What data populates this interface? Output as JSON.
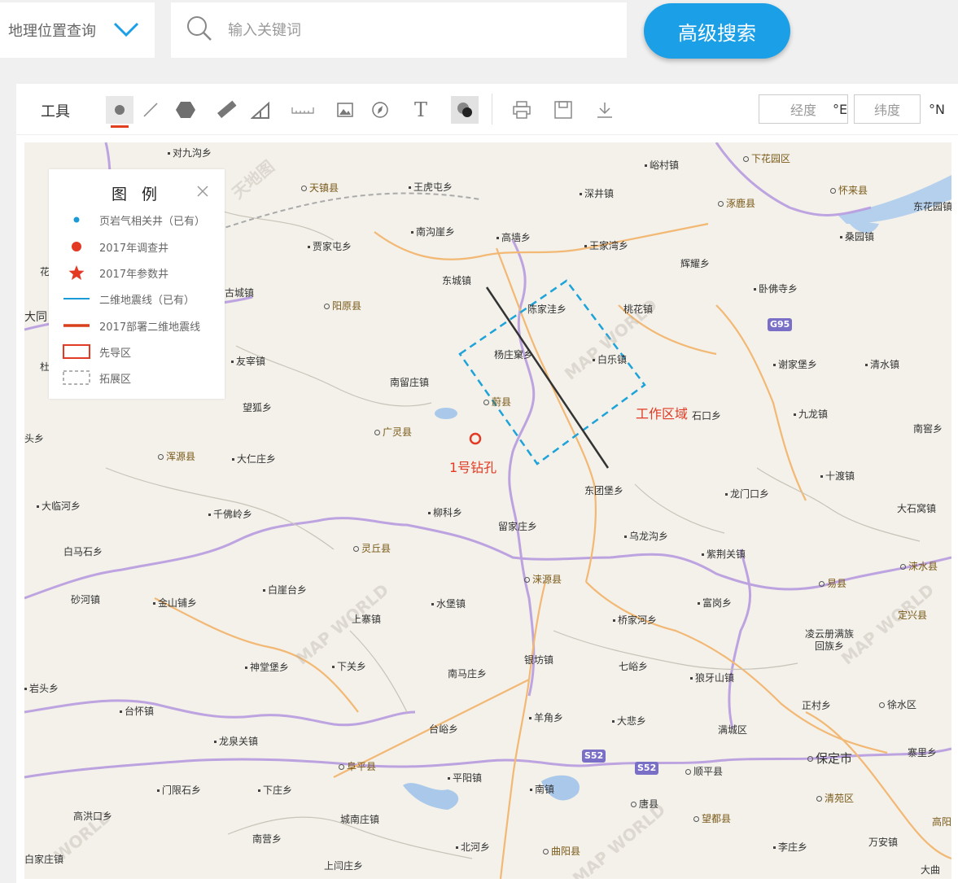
{
  "topbar": {
    "geo_select_label": "地理位置查询",
    "search_placeholder": "输入关键词",
    "advanced_search_label": "高级搜索",
    "accent_color": "#1ba0e8"
  },
  "toolbar": {
    "label": "工具",
    "tools": [
      "point-tool",
      "line-tool",
      "polygon-tool",
      "ruler-tool",
      "area-measure-tool",
      "scale-tool",
      "image-tool",
      "compass-tool",
      "text-tool",
      "layer-tool",
      "print-tool",
      "save-tool",
      "download-tool"
    ],
    "longitude_placeholder": "经度",
    "longitude_unit": "°E",
    "latitude_placeholder": "纬度",
    "latitude_unit": "°N"
  },
  "legend": {
    "title": "图 例",
    "items": [
      {
        "label": "页岩气相关井（已有）",
        "symbol": "blue-dot",
        "color": "#1a9ad6"
      },
      {
        "label": "2017年调查井",
        "symbol": "red-dot",
        "color": "#e23a24"
      },
      {
        "label": "2017年参数井",
        "symbol": "red-star",
        "color": "#e23a24"
      },
      {
        "label": "二维地震线（已有）",
        "symbol": "blue-line",
        "color": "#1a9ad6"
      },
      {
        "label": "2017部署二维地震线",
        "symbol": "red-line",
        "color": "#d8401c"
      },
      {
        "label": "先导区",
        "symbol": "red-rect",
        "color": "#e23a24"
      },
      {
        "label": "拓展区",
        "symbol": "gray-dashed-rect",
        "color": "#999999"
      }
    ]
  },
  "map": {
    "annotations": {
      "work_area": "工作区域",
      "borehole": "1号钻孔"
    },
    "road_shields": [
      "G95",
      "S52",
      "S52"
    ],
    "places": [
      "对九沟乡",
      "天镇县",
      "王虎屯乡",
      "深井镇",
      "峪村镇",
      "下花园区",
      "怀来县",
      "东花园镇",
      "涿鹿县",
      "南沟崖乡",
      "高墙乡",
      "王家湾乡",
      "桑园镇",
      "贾家屯乡",
      "辉耀乡",
      "东城镇",
      "卧佛寺乡",
      "阳原县",
      "陈家洼乡",
      "桃花镇",
      "大同",
      "杨庄窠乡",
      "白乐镇",
      "谢家堡乡",
      "清水镇",
      "友宰镇",
      "南留庄镇",
      "蔚县",
      "工作区域",
      "石口乡",
      "九龙镇",
      "望狐乡",
      "广灵县",
      "南窖乡",
      "浑源县",
      "大仁庄乡",
      "1号钻孔",
      "十渡镇",
      "东团堡乡",
      "大临河乡",
      "千佛岭乡",
      "柳科乡",
      "龙门口乡",
      "大石窝镇",
      "留家庄乡",
      "乌龙沟乡",
      "白马石乡",
      "灵丘县",
      "紫荆关镇",
      "涞水县",
      "涞源县",
      "易县",
      "砂河镇",
      "金山铺乡",
      "白崖台乡",
      "水堡镇",
      "富岗乡",
      "定兴县",
      "上寨镇",
      "桥家河乡",
      "凌云册满族回族乡",
      "银坊镇",
      "七峪乡",
      "神堂堡乡",
      "下关乡",
      "南马庄乡",
      "狼牙山镇",
      "岩头乡",
      "台怀镇",
      "正村乡",
      "徐水区",
      "羊角乡",
      "大悲乡",
      "台峪乡",
      "满城区",
      "龙泉关镇",
      "阜平县",
      "平阳镇",
      "顺平县",
      "保定市",
      "寨里乡",
      "门限石乡",
      "下庄乡",
      "南镇",
      "唐县",
      "清苑区",
      "高阳",
      "高洪口乡",
      "城南庄镇",
      "望都县",
      "南营乡",
      "北河乡",
      "曲阳县",
      "李庄乡",
      "万安镇",
      "白家庄镇",
      "上闫庄乡",
      "大曲",
      "花",
      "杜",
      "头乡",
      "古城镇",
      "东花园镇"
    ]
  }
}
